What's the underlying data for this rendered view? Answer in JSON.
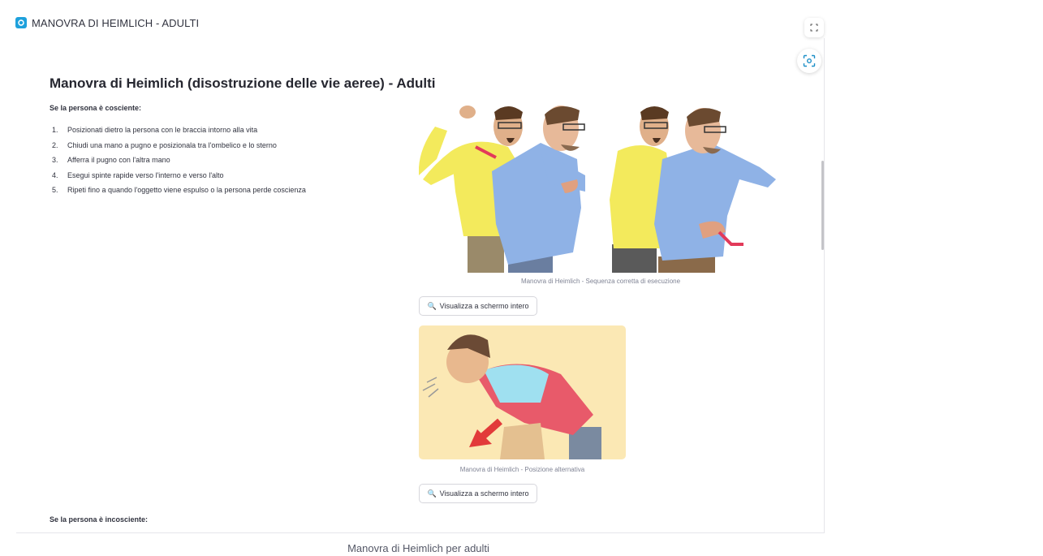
{
  "window": {
    "title": "MANOVRA DI HEIMLICH - ADULTI",
    "fullscreen_icon": "expand-icon",
    "screenshot_icon": "camera-capture-icon"
  },
  "content": {
    "title": "Manovra di Heimlich (disostruzione delle vie aeree) - Adulti",
    "conscious_heading": "Se la persona è cosciente:",
    "steps": [
      {
        "num": "1.",
        "text": "Posizionati dietro la persona con le braccia intorno alla vita"
      },
      {
        "num": "2.",
        "text": "Chiudi una mano a pugno e posizionala tra l'ombelico e lo sterno"
      },
      {
        "num": "3.",
        "text": "Afferra il pugno con l'altra mano"
      },
      {
        "num": "4.",
        "text": "Esegui spinte rapide verso l'interno e verso l'alto"
      },
      {
        "num": "5.",
        "text": "Ripeti fino a quando l'oggetto viene espulso o la persona perde coscienza"
      }
    ],
    "image1_caption": "Manovra di Heimlich - Sequenza corretta di esecuzione",
    "image2_caption": "Manovra di Heimlich - Posizione alternativa",
    "fullscreen_button_label": "Visualizza a schermo intero",
    "magnifier_glyph": "🔍",
    "unconscious_heading": "Se la persona è incosciente:"
  },
  "footer_caption": "Manovra di Heimlich per adulti"
}
